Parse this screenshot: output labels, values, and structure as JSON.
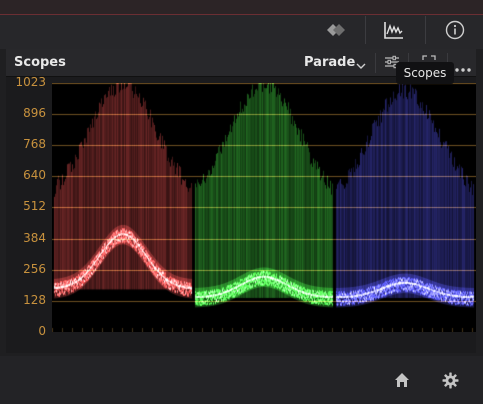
{
  "panel": {
    "title": "Scopes",
    "mode_label": "Parade"
  },
  "tooltip": {
    "text": "Scopes"
  },
  "scope": {
    "y_labels": [
      "1023",
      "896",
      "768",
      "640",
      "512",
      "384",
      "256",
      "128",
      "0"
    ],
    "channels": [
      "red",
      "green",
      "blue"
    ]
  },
  "icons": {
    "toolbar": [
      "color-wheels-icon",
      "scopes-waveform-icon",
      "info-icon"
    ],
    "header": [
      "scope-settings-icon",
      "fullscreen-icon",
      "more-options-icon"
    ],
    "bottom": [
      "home-icon",
      "settings-gear-icon"
    ]
  },
  "colors": {
    "graticule": "#c8923e",
    "red": "#ff5a5a",
    "green": "#4cff4c",
    "blue": "#5a5aff"
  }
}
